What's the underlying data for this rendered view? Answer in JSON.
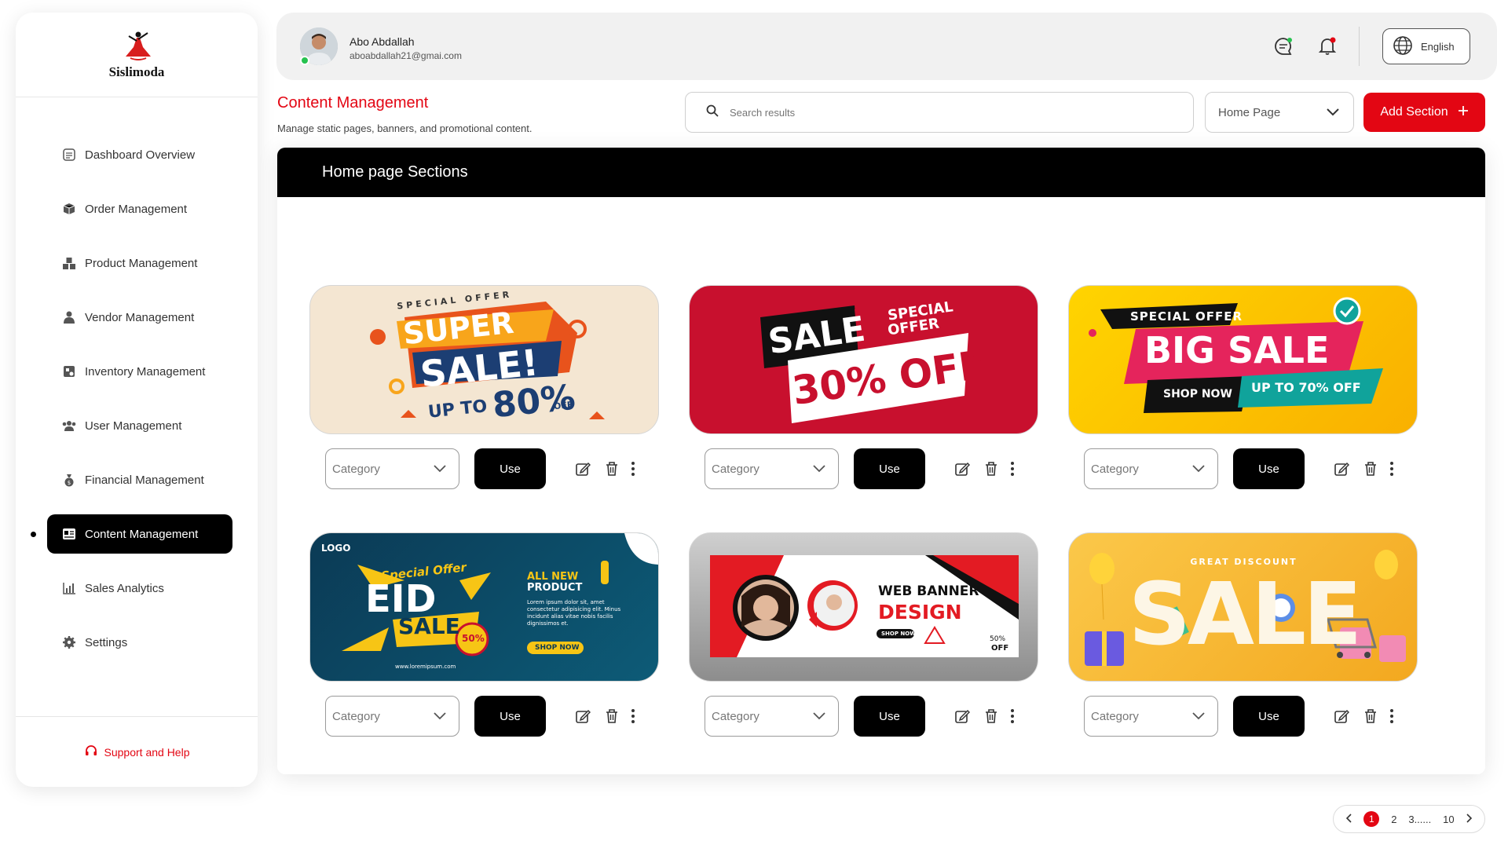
{
  "brand": {
    "name": "Sislimoda"
  },
  "sidebar": {
    "items": [
      {
        "label": "Dashboard Overview",
        "icon": "dashboard-icon"
      },
      {
        "label": "Order Management",
        "icon": "orders-icon"
      },
      {
        "label": "Product Management",
        "icon": "products-icon"
      },
      {
        "label": "Vendor Management",
        "icon": "vendor-icon"
      },
      {
        "label": "Inventory Management",
        "icon": "inventory-icon"
      },
      {
        "label": "User Management",
        "icon": "users-icon"
      },
      {
        "label": "Financial Management",
        "icon": "finance-icon"
      },
      {
        "label": "Content Management",
        "icon": "content-icon",
        "active": true
      },
      {
        "label": "Sales Analytics",
        "icon": "analytics-icon"
      },
      {
        "label": "Settings",
        "icon": "gear-icon"
      }
    ],
    "support_label": "Support and Help"
  },
  "header": {
    "user_name": "Abo Abdallah",
    "user_email": "aboabdallah21@gmai.com",
    "language": "English"
  },
  "page": {
    "title": "Content Management",
    "subtitle": "Manage static pages, banners, and promotional content.",
    "search_placeholder": "Search results",
    "page_select": "Home Page",
    "add_label": "Add Section",
    "section_title": "Home page Sections"
  },
  "tiles": {
    "category_placeholder": "Category",
    "use_label": "Use",
    "banners": [
      {
        "line1": "SPECIAL OFFER",
        "line2": "SUPER",
        "line3": "SALE!",
        "line4": "UP TO",
        "line5": "80%",
        "line6": "OFF"
      },
      {
        "line1": "SALE",
        "line2": "SPECIAL",
        "line3": "OFFER",
        "line4": "30% OFF"
      },
      {
        "line1": "SPECIAL OFFER",
        "line2": "BIG SALE",
        "line3": "SHOP NOW",
        "line4": "UP TO 70% OFF"
      },
      {
        "line1": "LOGO",
        "line2": "Special Offer",
        "line3": "EID",
        "line4": "SALE",
        "line5": "ALL NEW",
        "line6": "PRODUCT",
        "line7": "Lorem ipsum dolor sit, amet consectetur adipisicing elit. Minus incidunt alias vitae nobis facilis dignissimos et.",
        "line8": "SHOP NOW",
        "line9": "www.loremipsum.com",
        "line10": "50%"
      },
      {
        "line1": "WEB BANNER",
        "line2": "DESIGN",
        "line3": "SHOP NOW",
        "line4": "50%",
        "line5": "OFF"
      },
      {
        "line1": "GREAT DISCOUNT",
        "line2": "SALE"
      }
    ]
  },
  "pagination": {
    "current": "1",
    "p2": "2",
    "p3": "3......",
    "last": "10"
  },
  "colors": {
    "accent": "#e30613",
    "dark": "#000000"
  }
}
